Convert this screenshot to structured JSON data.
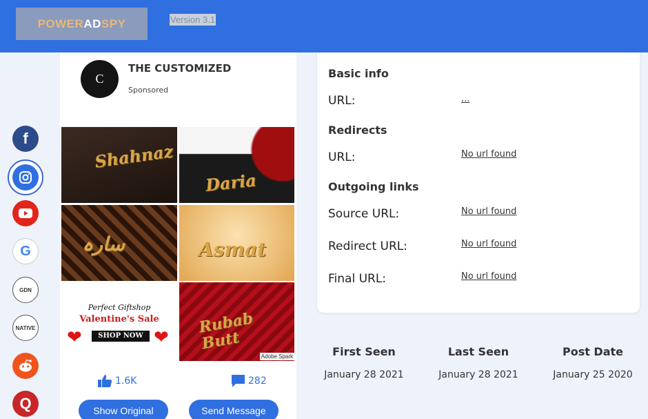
{
  "header": {
    "logo_pre": "POWER",
    "logo_mid": "AD",
    "logo_post": "SPY",
    "version": "Version 3.1"
  },
  "sidebar": {
    "networks": [
      "facebook-icon",
      "instagram-icon",
      "youtube-icon",
      "google-icon",
      "gdn-icon",
      "native-icon",
      "reddit-icon",
      "quora-icon"
    ],
    "fb_glyph": "f",
    "google_glyph": "G",
    "gdn_label": "GDN",
    "native_label": "NATIVE",
    "quora_glyph": "Q",
    "accent": "#2f6fe0"
  },
  "ad": {
    "advertiser": "THE CUSTOMIZED",
    "avatar_text": "C",
    "sponsored": "Sponsored",
    "tiles": {
      "t1": "Shahnaz",
      "t2": "Daria",
      "t3": "سارہ",
      "t4": "Asmat",
      "t6": "Rubab Butt"
    },
    "valentine": {
      "shop_name": "Perfect Giftshop",
      "sale": "Valentine's Sale",
      "cta": "SHOP NOW"
    },
    "adobe_badge": "Adobe Spark",
    "likes": "1.6K",
    "comments": "282",
    "show_original": "Show Original",
    "send_message": "Send Message"
  },
  "info": {
    "basic_title": "Basic info",
    "basic_url_label": "URL:",
    "basic_url_value": "...",
    "redirects_title": "Redirects",
    "redirects_url_label": "URL:",
    "redirects_url_value": "No url found",
    "outgoing_title": "Outgoing links",
    "source_label": "Source URL:",
    "source_value": "No url found",
    "redirect_label": "Redirect URL:",
    "redirect_value": "No url found",
    "final_label": "Final URL:",
    "final_value": "No url found"
  },
  "dates": {
    "first_seen_label": "First Seen",
    "first_seen": "January 28 2021",
    "last_seen_label": "Last Seen",
    "last_seen": "January 28 2021",
    "post_date_label": "Post Date",
    "post_date": "January 25 2020"
  }
}
